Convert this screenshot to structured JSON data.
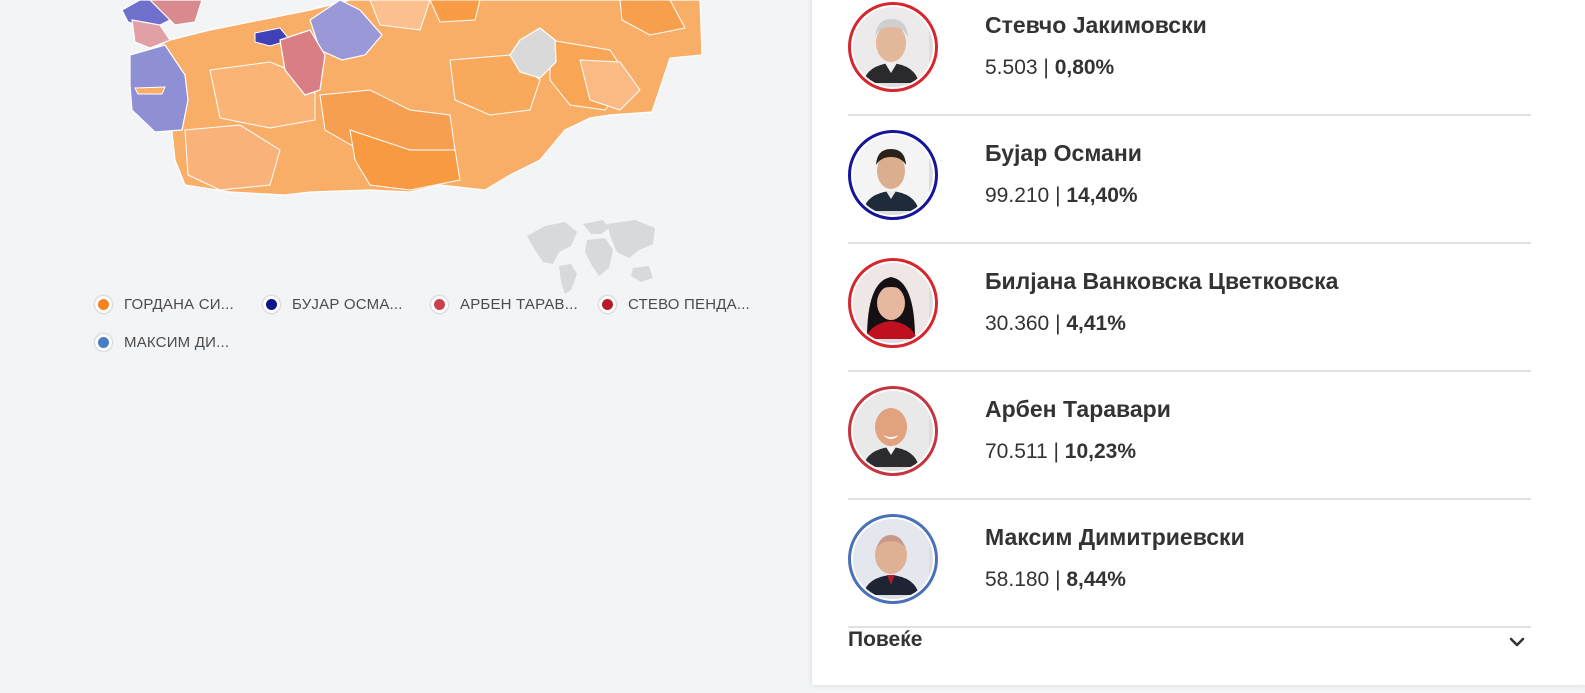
{
  "colors": {
    "orange": "#f7931e",
    "blue_dark": "#1a1a9a",
    "red": "#c73b45",
    "red_dark": "#c0202b",
    "blue": "#4a7cc4",
    "map_orange": "#f9ae68",
    "map_lavender": "#9b98d8",
    "map_pink": "#d98a8e"
  },
  "legend": [
    {
      "label": "ГОРДАНА СИ...",
      "color": "#f58220"
    },
    {
      "label": "БУЈАР ОСМА...",
      "color": "#10138c"
    },
    {
      "label": "АРБЕН ТАРАВ...",
      "color": "#c8414a"
    },
    {
      "label": "СТЕВО ПЕНДА...",
      "color": "#b71c2a"
    },
    {
      "label": "МАКСИМ ДИ...",
      "color": "#4a7cc4"
    }
  ],
  "candidates": [
    {
      "name": "Стевчо Јакимовски",
      "votes": "5.503",
      "percent": "0,80%",
      "ring_color": "#d6262e",
      "avatar_icon": "man-gray-hair-icon"
    },
    {
      "name": "Бујар Османи",
      "votes": "99.210",
      "percent": "14,40%",
      "ring_color": "#15159a",
      "avatar_icon": "man-dark-hair-icon"
    },
    {
      "name": "Билјана Ванковска Цветковска",
      "votes": "30.360",
      "percent": "4,41%",
      "ring_color": "#d6262e",
      "avatar_icon": "woman-dark-hair-icon"
    },
    {
      "name": "Арбен Таравари",
      "votes": "70.511",
      "percent": "10,23%",
      "ring_color": "#c4353f",
      "avatar_icon": "man-bald-icon"
    },
    {
      "name": "Максим Димитриевски",
      "votes": "58.180",
      "percent": "8,44%",
      "ring_color": "#4a70b8",
      "avatar_icon": "man-bald-icon"
    }
  ],
  "more": {
    "label": "Повеќе",
    "icon": "chevron-down-icon"
  }
}
